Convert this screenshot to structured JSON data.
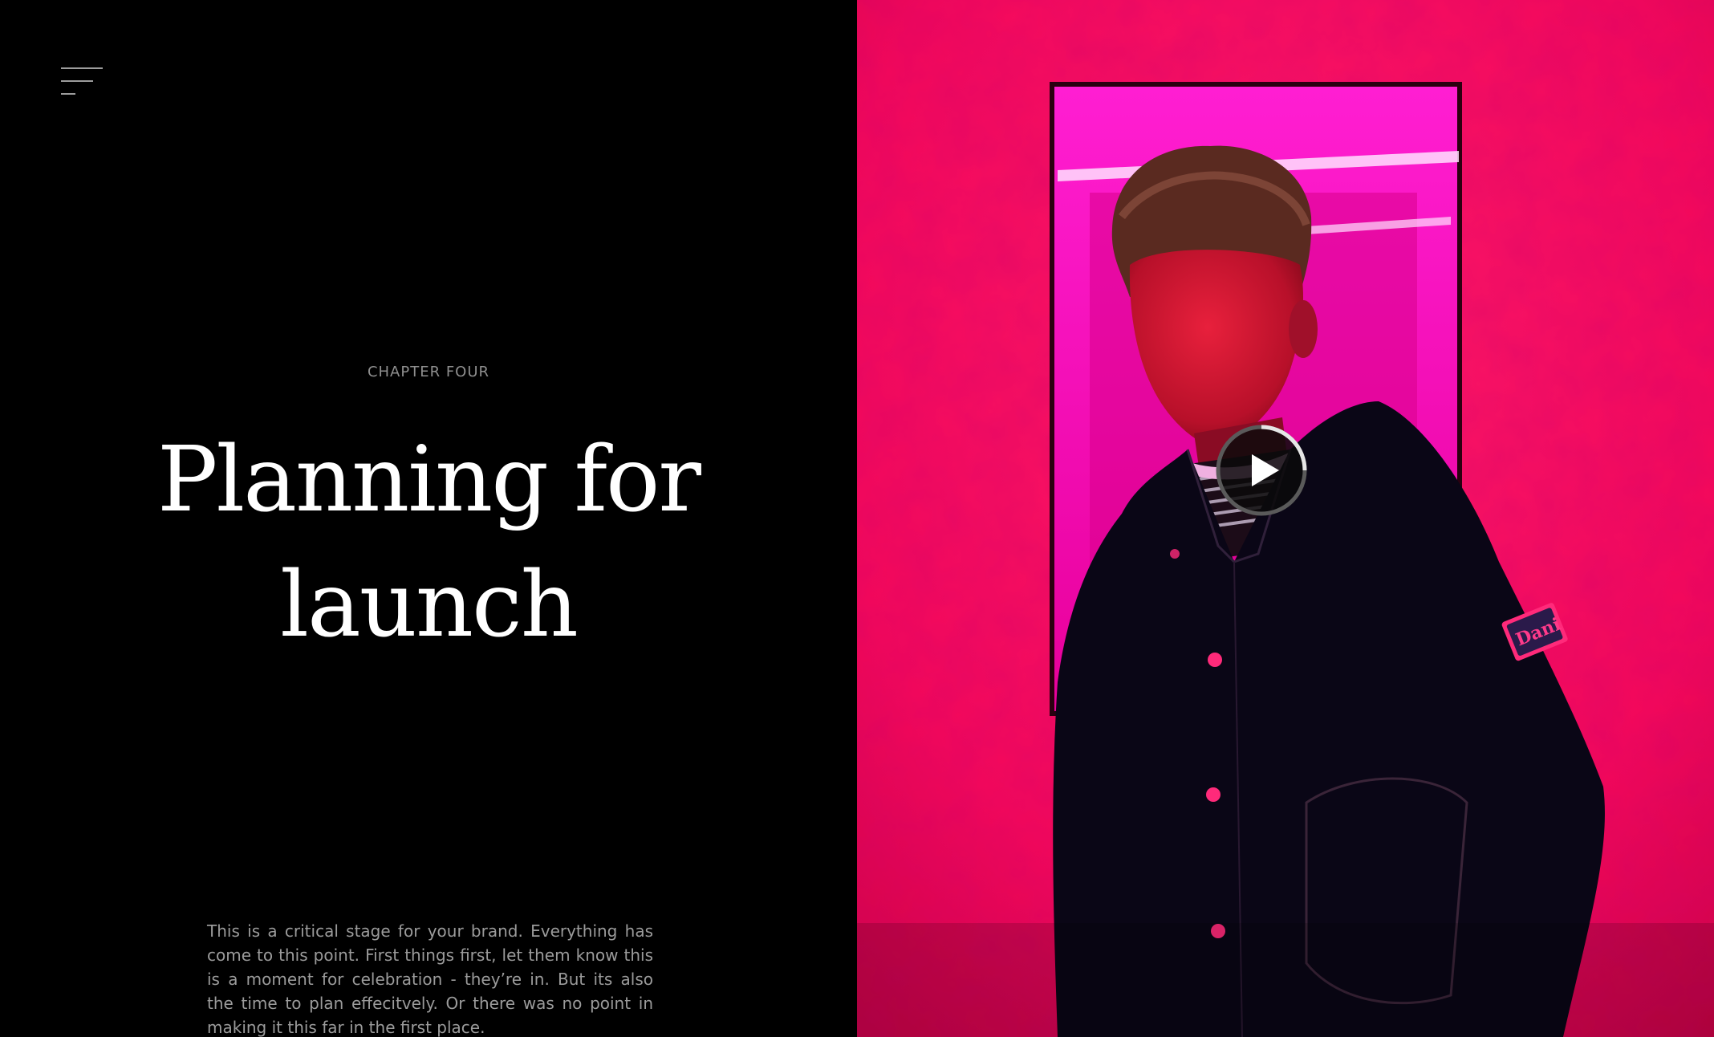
{
  "menu": {
    "icon": "hamburger-menu-icon"
  },
  "chapter": {
    "label": "CHAPTER FOUR"
  },
  "hero": {
    "title_line1": "Planning for",
    "title_line2": "launch"
  },
  "body": {
    "text": "This is a critical stage for your brand.  Everything has come to this point. First things first, let them know this is a moment for celebration - they’re in.  But its also the time to plan effecitvely.  Or there was no point in making it this far in the first place."
  },
  "media": {
    "image": "portrait-photo",
    "play_icon": "play-icon",
    "progress": 0.25,
    "sleeve_patch_text": "Dani"
  },
  "colors": {
    "background": "#000000",
    "accent_pink": "#ff0a5a",
    "magenta_frame": "#ff14c8",
    "title": "#ffffff",
    "muted_text": "#9b9b9b"
  }
}
